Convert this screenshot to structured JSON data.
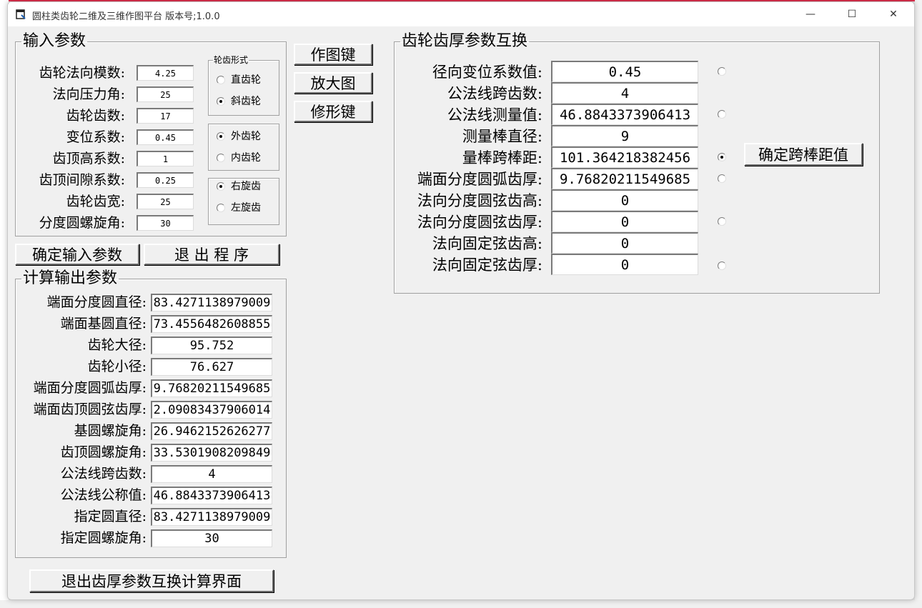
{
  "window": {
    "title": "圆柱类齿轮二维及三维作图平台 版本号;1.0.0",
    "min_glyph": "—",
    "max_glyph": "☐",
    "close_glyph": "✕"
  },
  "input_group": {
    "legend": "输入参数",
    "fields": [
      {
        "label": "齿轮法向模数:",
        "value": "4.25"
      },
      {
        "label": "法向压力角:",
        "value": "25"
      },
      {
        "label": "齿轮齿数:",
        "value": "17"
      },
      {
        "label": "变位系数:",
        "value": "0.45"
      },
      {
        "label": "齿顶高系数:",
        "value": "1"
      },
      {
        "label": "齿顶间隙系数:",
        "value": "0.25"
      },
      {
        "label": "齿轮齿宽:",
        "value": "25"
      },
      {
        "label": "分度圆螺旋角:",
        "value": "30"
      }
    ],
    "gear_form": {
      "legend": "轮齿形式",
      "options": [
        {
          "label": "直齿轮",
          "checked": false
        },
        {
          "label": "斜齿轮",
          "checked": true
        }
      ]
    },
    "gear_type": {
      "options": [
        {
          "label": "外齿轮",
          "checked": true
        },
        {
          "label": "内齿轮",
          "checked": false
        }
      ]
    },
    "hand": {
      "options": [
        {
          "label": "右旋齿",
          "checked": true
        },
        {
          "label": "左旋齿",
          "checked": false
        }
      ]
    }
  },
  "side_buttons": {
    "draw": "作图键",
    "zoom": "放大图",
    "modify": "修形键"
  },
  "main_buttons": {
    "confirm_input": "确定输入参数",
    "exit_program": "退 出 程 序",
    "exit_thickness": "退出齿厚参数互换计算界面"
  },
  "output_group": {
    "legend": "计算输出参数",
    "fields": [
      {
        "label": "端面分度圆直径:",
        "value": "83.4271138979009"
      },
      {
        "label": "端面基圆直径:",
        "value": "73.4556482608855"
      },
      {
        "label": "齿轮大径:",
        "value": "95.752"
      },
      {
        "label": "齿轮小径:",
        "value": "76.627"
      },
      {
        "label": "端面分度圆弧齿厚:",
        "value": "9.76820211549685"
      },
      {
        "label": "端面齿顶圆弦齿厚:",
        "value": "2.09083437906014"
      },
      {
        "label": "基圆螺旋角:",
        "value": "26.9462152626277"
      },
      {
        "label": "齿顶圆螺旋角:",
        "value": "33.5301908209849"
      },
      {
        "label": "公法线跨齿数:",
        "value": "4"
      },
      {
        "label": "公法线公称值:",
        "value": "46.8843373906413"
      },
      {
        "label": "指定圆直径:",
        "value": "83.4271138979009"
      },
      {
        "label": "指定圆螺旋角:",
        "value": "30"
      }
    ]
  },
  "thickness_group": {
    "legend": "齿轮齿厚参数互换",
    "confirm_button": "确定跨棒距值",
    "fields": [
      {
        "label": "径向变位系数值:",
        "value": "0.45",
        "radio": "unchecked"
      },
      {
        "label": "公法线跨齿数:",
        "value": "4",
        "radio": "none"
      },
      {
        "label": "公法线测量值:",
        "value": "46.8843373906413",
        "radio": "unchecked"
      },
      {
        "label": "测量棒直径:",
        "value": "9",
        "radio": "none"
      },
      {
        "label": "量棒跨棒距:",
        "value": "101.364218382456",
        "radio": "checked"
      },
      {
        "label": "端面分度圆弧齿厚:",
        "value": "9.76820211549685",
        "radio": "unchecked"
      },
      {
        "label": "法向分度圆弦齿高:",
        "value": "0",
        "radio": "none"
      },
      {
        "label": "法向分度圆弦齿厚:",
        "value": "0",
        "radio": "unchecked"
      },
      {
        "label": "法向固定弦齿高:",
        "value": "0",
        "radio": "none"
      },
      {
        "label": "法向固定弦齿厚:",
        "value": "0",
        "radio": "unchecked"
      }
    ]
  }
}
